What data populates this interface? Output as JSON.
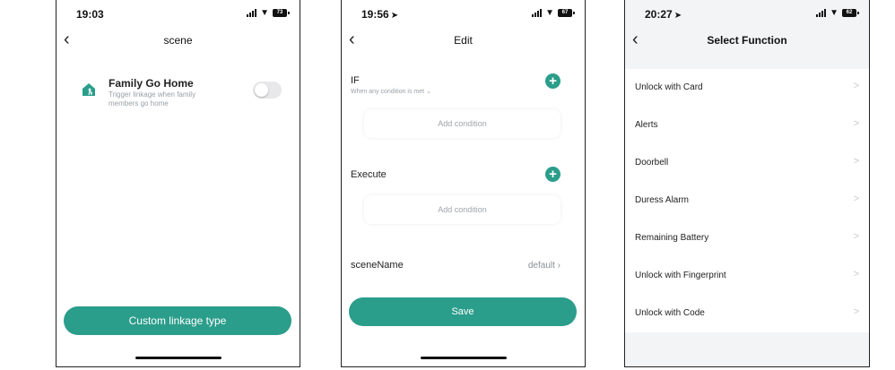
{
  "screen1": {
    "status": {
      "time": "19:03",
      "battery": "73"
    },
    "nav": {
      "back": "‹",
      "title": "scene"
    },
    "scene": {
      "name": "Family Go Home",
      "description": "Trigger linkage when family members go home",
      "toggle_on": false
    },
    "button": "Custom linkage type"
  },
  "screen2": {
    "status": {
      "time": "19:56",
      "battery": "67"
    },
    "nav": {
      "back": "‹",
      "title": "Edit"
    },
    "if_section": {
      "label": "IF",
      "sub": "When any condition is met ⌄",
      "add": "Add condition"
    },
    "execute_section": {
      "label": "Execute",
      "add": "Add condition"
    },
    "scene_name": {
      "label": "sceneName",
      "value": "default ›"
    },
    "button": "Save"
  },
  "screen3": {
    "status": {
      "time": "20:27",
      "battery": "62"
    },
    "nav": {
      "back": "‹",
      "title": "Select Function"
    },
    "functions": [
      "Unlock with Card",
      "Alerts",
      "Doorbell",
      "Duress Alarm",
      "Remaining Battery",
      "Unlock with Fingerprint",
      "Unlock with Code"
    ]
  },
  "colors": {
    "accent": "#2b9d8b",
    "muted": "#9aa0a6"
  },
  "icons": {
    "back": "chevron-left-icon",
    "add": "plus-circle-icon",
    "scene": "house-person-icon"
  }
}
